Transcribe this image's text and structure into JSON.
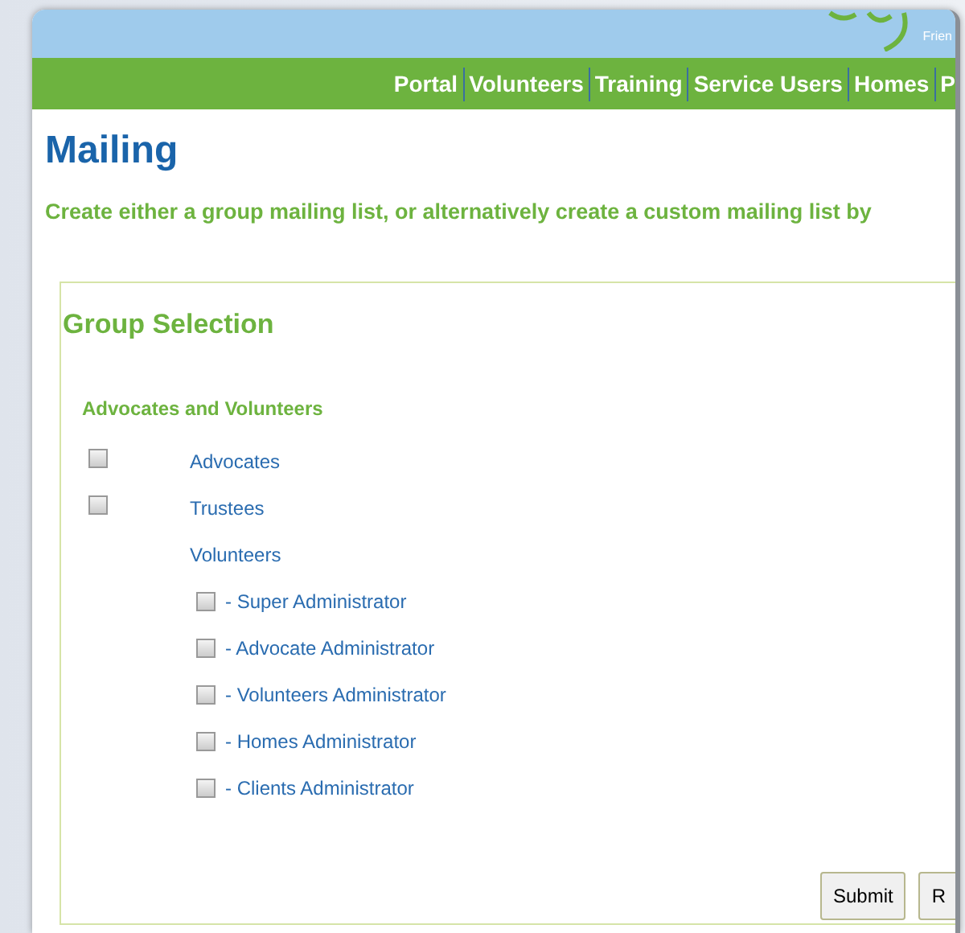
{
  "header": {
    "logo_text": "Frien"
  },
  "nav": [
    "Portal",
    "Volunteers",
    "Training",
    "Service Users",
    "Homes",
    "P"
  ],
  "page": {
    "title": "Mailing",
    "intro": "Create either a group mailing list, or alternatively create a custom mailing list by"
  },
  "group_selection": {
    "title": "Group Selection",
    "section": "Advocates and Volunteers",
    "items": [
      {
        "label": "Advocates",
        "kind": "checkbox",
        "checked": false
      },
      {
        "label": "Trustees",
        "kind": "checkbox",
        "checked": false
      },
      {
        "label": "Volunteers",
        "kind": "heading",
        "children": [
          {
            "label": "- Super Administrator",
            "checked": false
          },
          {
            "label": "- Advocate Administrator",
            "checked": false
          },
          {
            "label": "- Volunteers Administrator",
            "checked": false
          },
          {
            "label": "- Homes Administrator",
            "checked": false
          },
          {
            "label": "- Clients Administrator",
            "checked": false
          }
        ]
      }
    ]
  },
  "buttons": [
    "Submit",
    "R"
  ]
}
